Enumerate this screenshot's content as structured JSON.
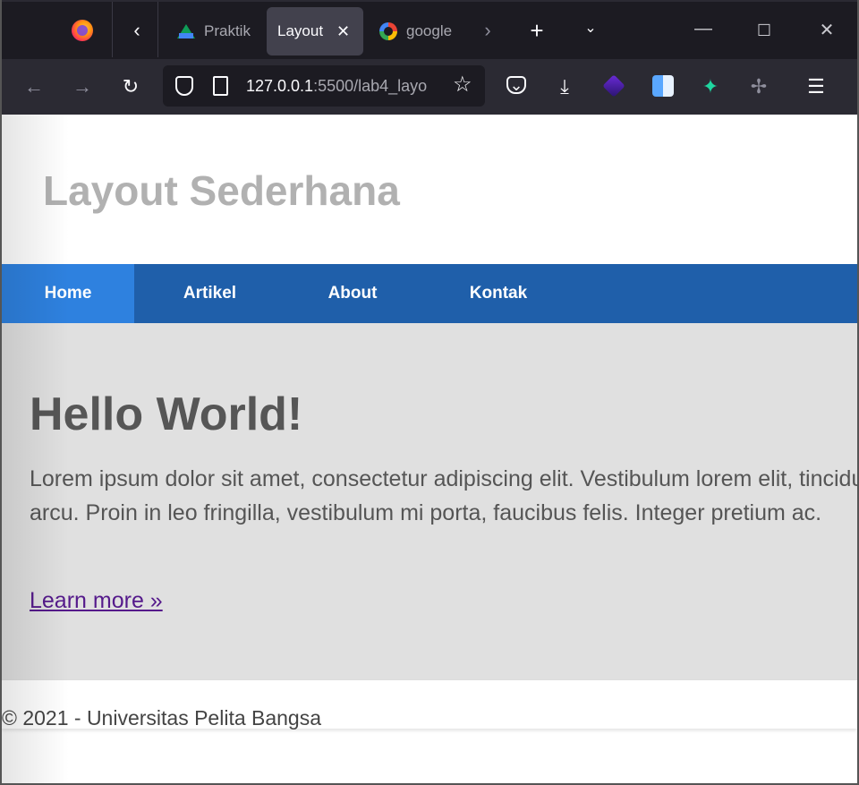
{
  "browser": {
    "tabs": [
      {
        "label": "Praktik",
        "icon": "google-drive-icon",
        "active": false
      },
      {
        "label": "Layout",
        "icon": "none",
        "active": true
      },
      {
        "label": "google",
        "icon": "google-icon",
        "active": false
      }
    ],
    "url_host": "127.0.0.1",
    "url_rest": ":5500/lab4_layo",
    "icons": [
      "firefox-icon",
      "back-icon",
      "forward-icon",
      "reload-icon",
      "shield-icon",
      "page-icon",
      "star-icon",
      "pocket-icon",
      "download-icon",
      "extension-icon",
      "extensions-menu-icon"
    ]
  },
  "site": {
    "title": "Layout Sederhana",
    "nav": [
      "Home",
      "Artikel",
      "About",
      "Kontak"
    ],
    "active_nav": "Home",
    "hero": {
      "heading": "Hello World!",
      "body": "Lorem ipsum dolor sit amet, consectetur adipiscing elit. Vestibulum lorem elit, tincidunt arcu. Proin in leo fringilla, vestibulum mi porta, faucibus felis. Integer pretium ac.",
      "link": "Learn more »"
    },
    "footer": "© 2021 - Universitas Pelita Bangsa"
  },
  "colors": {
    "nav_bg": "#1f5faa",
    "nav_active": "#2e81df",
    "hero_bg": "#e0e0e0",
    "title_color": "#b1b1b1",
    "link_visited": "#551a8b"
  }
}
